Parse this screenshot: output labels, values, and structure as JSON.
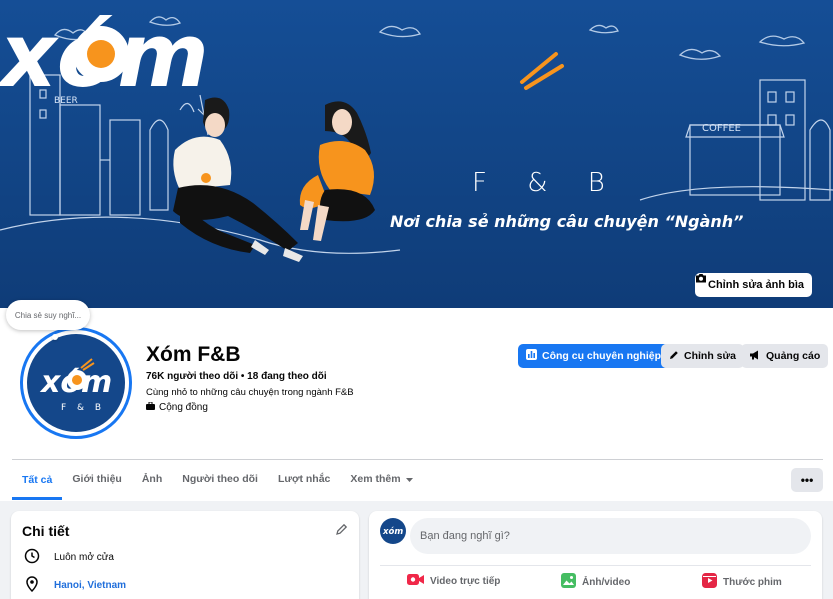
{
  "cover": {
    "wordmark": "xóm",
    "subtitle": "F & B",
    "tagline": "Nơi chia sẻ những câu chuyện “Ngành”",
    "sign_beer": "BEER",
    "sign_coffee": "COFFEE",
    "edit_label": "Chỉnh sửa ảnh bìa"
  },
  "thought_bubble": "Chia sẻ suy nghĩ...",
  "avatar": {
    "wordmark": "xóm",
    "sub": "F & B"
  },
  "page": {
    "name": "Xóm F&B",
    "stats": "76K người theo dõi • 18 đang theo dõi",
    "description": "Cùng nhỏ to những câu chuyện trong ngành F&B",
    "category": "Cộng đồng"
  },
  "actions": {
    "pro_tools": "Công cụ chuyên nghiệp",
    "edit": "Chỉnh sửa",
    "ads": "Quảng cáo"
  },
  "tabs": [
    {
      "label": "Tất cả"
    },
    {
      "label": "Giới thiệu"
    },
    {
      "label": "Ảnh"
    },
    {
      "label": "Người theo dõi"
    },
    {
      "label": "Lượt nhắc"
    },
    {
      "label": "Xem thêm"
    }
  ],
  "more_button": "•••",
  "details": {
    "title": "Chi tiết",
    "hours": "Luôn mở cửa",
    "location": "Hanoi, Vietnam"
  },
  "composer": {
    "avatar_text": "xóm",
    "placeholder": "Bạn đang nghĩ gì?",
    "live_video": "Video trực tiếp",
    "photo_video": "Ảnh/video",
    "reel": "Thước phim"
  },
  "colors": {
    "accent": "#1877f2",
    "cover_blue": "#14478a",
    "brand_orange": "#f7941d"
  }
}
